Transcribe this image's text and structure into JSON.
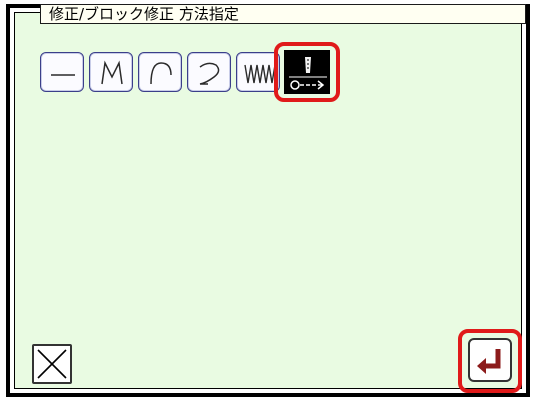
{
  "title": "修正/ブロック修正 方法指定",
  "tools": [
    {
      "name": "straight-line-tool-icon"
    },
    {
      "name": "zigzag-tool-icon"
    },
    {
      "name": "arc-tool-icon"
    },
    {
      "name": "curve-tool-icon"
    },
    {
      "name": "zigzag-stitch-tool-icon"
    },
    {
      "name": "point-move-tool-icon"
    }
  ],
  "colors": {
    "panel_bg": "#e9fbe2",
    "highlight": "#e01a1a",
    "enter_arrow": "#8c1b1b"
  }
}
